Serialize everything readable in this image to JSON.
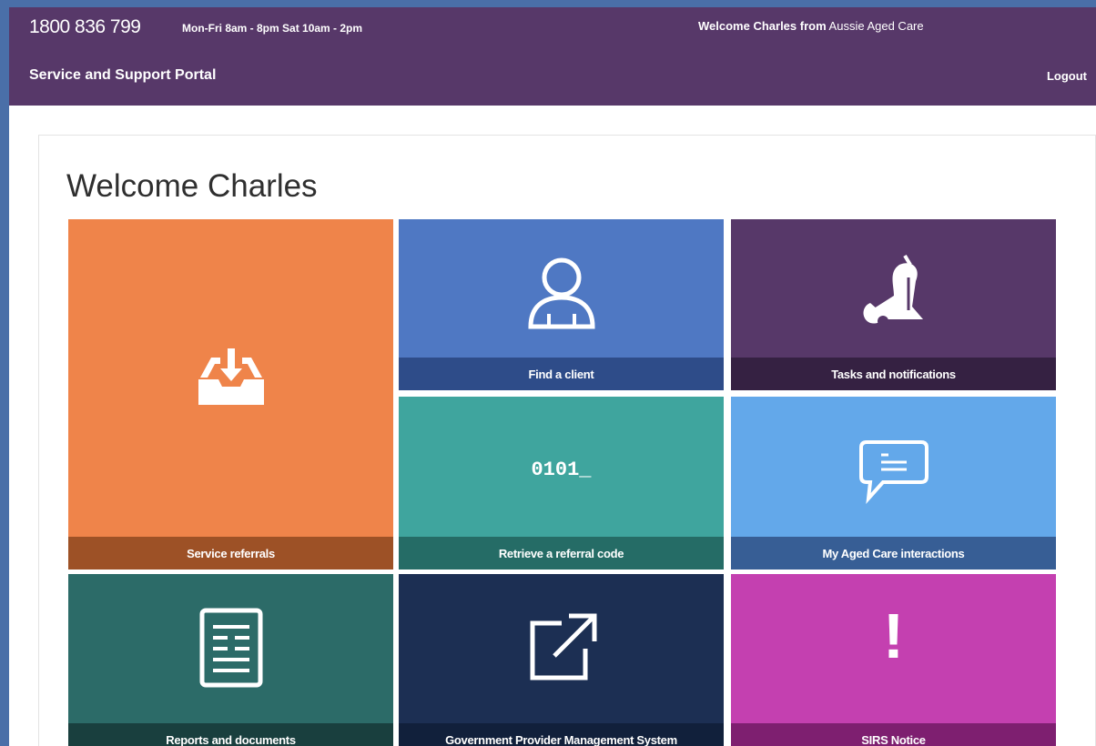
{
  "header": {
    "phone": "1800 836 799",
    "hours": "Mon-Fri 8am - 8pm Sat 10am - 2pm",
    "welcome_prefix": "Welcome Charles from",
    "organisation": "Aussie Aged Care",
    "portal_title": "Service and Support Portal",
    "logout_label": "Logout"
  },
  "main": {
    "title": "Welcome Charles",
    "tiles": [
      {
        "label": "Service referrals",
        "icon": "inbox-download-icon",
        "color": "#ef844a"
      },
      {
        "label": "Find a client",
        "icon": "user-icon",
        "color": "#4f78c3"
      },
      {
        "label": "Tasks and notifications",
        "icon": "bell-icon",
        "color": "#573869"
      },
      {
        "label": "Retrieve a referral code",
        "icon": "code-icon",
        "icon_text": "0101_",
        "color": "#3fa59e"
      },
      {
        "label": "My Aged Care interactions",
        "icon": "chat-icon",
        "color": "#63a8ea"
      },
      {
        "label": "Reports and documents",
        "icon": "document-icon",
        "color": "#2c6b68"
      },
      {
        "label": "Government Provider Management System",
        "icon": "external-link-icon",
        "color": "#1c2f53"
      },
      {
        "label": "SIRS Notice",
        "icon": "exclamation-icon",
        "icon_text": "!",
        "color": "#c440b0"
      }
    ]
  }
}
